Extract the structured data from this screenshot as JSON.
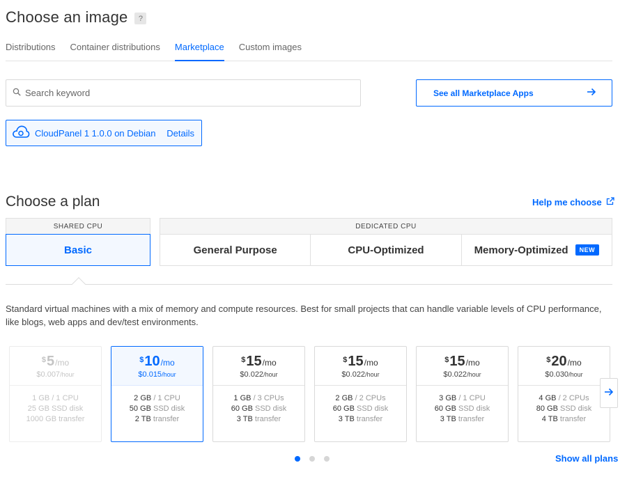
{
  "header": {
    "title": "Choose an image",
    "help_badge": "?"
  },
  "image_tabs": [
    {
      "label": "Distributions",
      "active": false
    },
    {
      "label": "Container distributions",
      "active": false
    },
    {
      "label": "Marketplace",
      "active": true
    },
    {
      "label": "Custom images",
      "active": false
    }
  ],
  "search": {
    "placeholder": "Search keyword",
    "value": ""
  },
  "marketplace_link": {
    "label": "See all Marketplace Apps",
    "icon": "arrow-right-icon"
  },
  "selected_app": {
    "name": "CloudPanel 1 1.0.0 on Debian ...",
    "details_label": "Details",
    "icon": "cloud-icon"
  },
  "plan": {
    "title": "Choose a plan",
    "help_label": "Help me choose",
    "help_icon": "external-link-icon",
    "shared_header": "SHARED CPU",
    "dedicated_header": "DEDICATED CPU",
    "shared_tabs": [
      {
        "label": "Basic",
        "active": true
      }
    ],
    "dedicated_tabs": [
      {
        "label": "General Purpose"
      },
      {
        "label": "CPU-Optimized"
      },
      {
        "label": "Memory-Optimized",
        "badge": "NEW"
      }
    ],
    "description": "Standard virtual machines with a mix of memory and compute resources. Best for small projects that can handle variable levels of CPU performance, like blogs, web apps and dev/test environments."
  },
  "price_cards": [
    {
      "currency": "$",
      "amount": "5",
      "period": "/mo",
      "hourly": "$0.007",
      "hourly_unit": "/hour",
      "ram": "1 GB",
      "cpu": "/ 1 CPU",
      "disk": "25 GB",
      "disk_label": "SSD disk",
      "transfer": "1000 GB",
      "transfer_label": "transfer",
      "state": "disabled"
    },
    {
      "currency": "$",
      "amount": "10",
      "period": "/mo",
      "hourly": "$0.015",
      "hourly_unit": "/hour",
      "ram": "2 GB",
      "cpu": "/ 1 CPU",
      "disk": "50 GB",
      "disk_label": "SSD disk",
      "transfer": "2 TB",
      "transfer_label": "transfer",
      "state": "selected"
    },
    {
      "currency": "$",
      "amount": "15",
      "period": "/mo",
      "hourly": "$0.022",
      "hourly_unit": "/hour",
      "ram": "1 GB",
      "cpu": "/ 3 CPUs",
      "disk": "60 GB",
      "disk_label": "SSD disk",
      "transfer": "3 TB",
      "transfer_label": "transfer",
      "state": "normal"
    },
    {
      "currency": "$",
      "amount": "15",
      "period": "/mo",
      "hourly": "$0.022",
      "hourly_unit": "/hour",
      "ram": "2 GB",
      "cpu": "/ 2 CPUs",
      "disk": "60 GB",
      "disk_label": "SSD disk",
      "transfer": "3 TB",
      "transfer_label": "transfer",
      "state": "normal"
    },
    {
      "currency": "$",
      "amount": "15",
      "period": "/mo",
      "hourly": "$0.022",
      "hourly_unit": "/hour",
      "ram": "3 GB",
      "cpu": "/ 1 CPU",
      "disk": "60 GB",
      "disk_label": "SSD disk",
      "transfer": "3 TB",
      "transfer_label": "transfer",
      "state": "normal"
    },
    {
      "currency": "$",
      "amount": "20",
      "period": "/mo",
      "hourly": "$0.030",
      "hourly_unit": "/hour",
      "ram": "4 GB",
      "cpu": "/ 2 CPUs",
      "disk": "80 GB",
      "disk_label": "SSD disk",
      "transfer": "4 TB",
      "transfer_label": "transfer",
      "state": "normal"
    }
  ],
  "carousel": {
    "next_icon": "arrow-right-icon",
    "page_count": 3,
    "active_page": 1
  },
  "show_all_label": "Show all plans",
  "colors": {
    "accent": "#0069ff",
    "selected_bg": "#f3f8ff",
    "border": "#d9d9d9",
    "text": "#333333"
  }
}
